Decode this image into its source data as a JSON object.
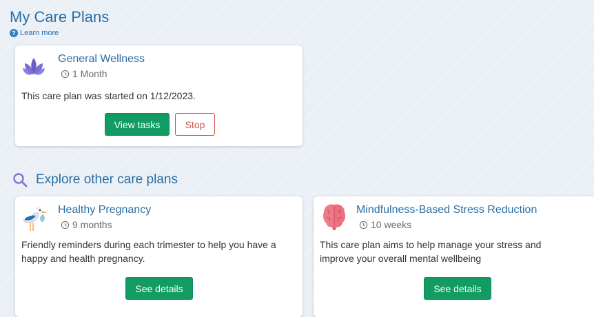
{
  "page": {
    "title": "My Care Plans",
    "learn_more": "Learn more"
  },
  "active_plan": {
    "icon": "lotus-icon",
    "title": "General Wellness",
    "duration": "1 Month",
    "description": "This care plan was started on 1/12/2023.",
    "primary_button": "View tasks",
    "secondary_button": "Stop"
  },
  "explore": {
    "title": "Explore other care plans",
    "plans": [
      {
        "icon": "stork-icon",
        "title": "Healthy Pregnancy",
        "duration": "9 months",
        "description": "Friendly reminders during each trimester to help you have a happy and health pregnancy.",
        "button": "See details"
      },
      {
        "icon": "brain-icon",
        "title": "Mindfulness-Based Stress Reduction",
        "duration": "10 weeks",
        "description": "This care plan aims to help manage your stress and improve your overall mental wellbeing",
        "button": "See details"
      }
    ]
  },
  "colors": {
    "accent": "#2b6ea6",
    "primary_button": "#129b63",
    "stop_button": "#d0534f",
    "background": "#eaf0f6"
  }
}
